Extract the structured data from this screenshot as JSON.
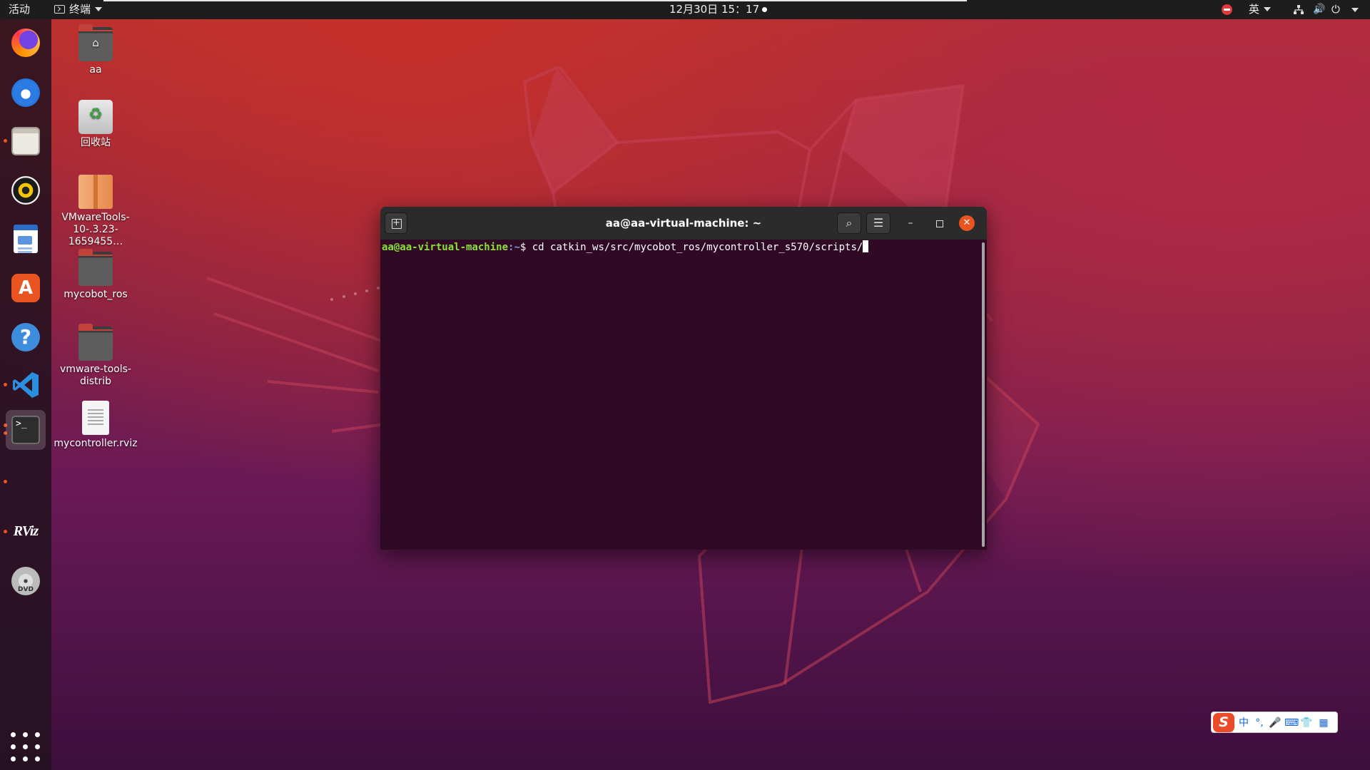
{
  "topbar": {
    "activities": "活动",
    "app_menu": "终端",
    "clock": "12月30日  15：17",
    "language": "英"
  },
  "dock": {
    "items": [
      "firefox-icon",
      "thunderbird-icon",
      "files-icon",
      "rhythmbox-icon",
      "libreoffice-writer-icon",
      "ubuntu-software-icon",
      "help-icon",
      "vscode-icon",
      "terminal-icon",
      "rviz-icon",
      "dvd-icon",
      "show-applications-icon"
    ],
    "terminal_glyph": ">_",
    "rviz_label": "RViz",
    "dvd_label": "DVD",
    "software_glyph": "A",
    "help_glyph": "?"
  },
  "desktop": {
    "icons": [
      {
        "label": "aa",
        "type": "home-folder-icon"
      },
      {
        "label": "回收站",
        "type": "trash-icon"
      },
      {
        "label": "VMwareTools-10-.3.23-1659455…",
        "type": "archive-icon"
      },
      {
        "label": "mycobot_ros",
        "type": "folder-icon"
      },
      {
        "label": "vmware-tools-distrib",
        "type": "folder-icon"
      },
      {
        "label": "mycontroller.rviz",
        "type": "document-icon"
      }
    ]
  },
  "terminal": {
    "title": "aa@aa-virtual-machine: ~",
    "prompt_user": "aa@aa-virtual-machine",
    "prompt_path": ":~",
    "prompt_symbol": "$ ",
    "command": "cd catkin_ws/src/mycobot_ros/mycontroller_s570/scripts/"
  },
  "ime": {
    "logo": "S",
    "mode": "中",
    "punct": "°,",
    "colors": {
      "brand": "#ea4b29",
      "accent": "#1463d2"
    }
  },
  "colors": {
    "accent": "#e95420",
    "terminal_bg": "#300a24",
    "prompt_user": "#8ae234",
    "prompt_path": "#729fcf"
  }
}
